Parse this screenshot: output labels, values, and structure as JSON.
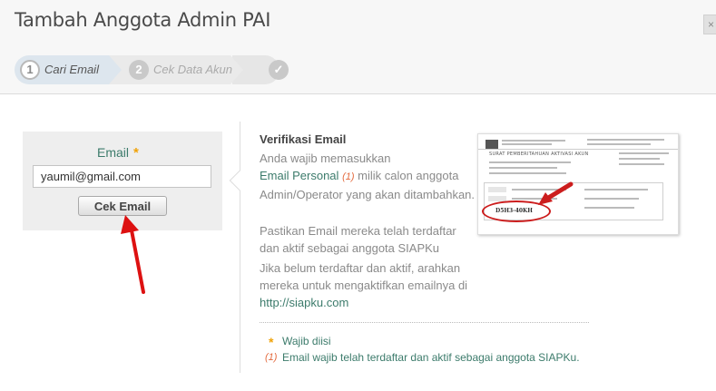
{
  "dialog": {
    "title": "Tambah Anggota Admin PAI",
    "close_label": "×"
  },
  "wizard": {
    "steps": [
      {
        "number": "1",
        "label": "Cari Email",
        "state": "active"
      },
      {
        "number": "2",
        "label": "Cek Data Akun",
        "state": "inactive"
      },
      {
        "number": "",
        "label": "",
        "state": "finish",
        "icon": "check-icon"
      }
    ]
  },
  "form": {
    "email_label": "Email",
    "required_mark": "*",
    "email_value": "yaumil@gmail.com",
    "check_button": "Cek Email"
  },
  "info": {
    "title": "Verifikasi Email",
    "p1_pre": "Anda wajib memasukkan",
    "p1_highlight": "Email Personal",
    "p1_ref": "(1)",
    "p1_post": "milik calon anggota Admin/Operator yang akan ditambahkan.",
    "p2": "Pastikan Email mereka telah terdaftar dan aktif sebagai anggota SIAPKu",
    "p3_pre": "Jika belum terdaftar dan aktif, arahkan mereka untuk mengaktifkan emailnya di",
    "p3_link": "http://siapku.com"
  },
  "thumbnail": {
    "doc_title": "SURAT PEMBERITAHUAN AKTIVASI AKUN",
    "code": "D5H3-40KH"
  },
  "footnotes": {
    "req_star": "*",
    "req_text": "Wajib diisi",
    "ref_mark": "(1)",
    "ref_text": "Email wajib telah terdaftar dan aktif sebagai anggota SIAPKu."
  },
  "colors": {
    "accent_green": "#3c7b6b",
    "required_orange": "#f0a30a",
    "reference_orange": "#e36a3e",
    "annotation_red": "#dd1111"
  }
}
